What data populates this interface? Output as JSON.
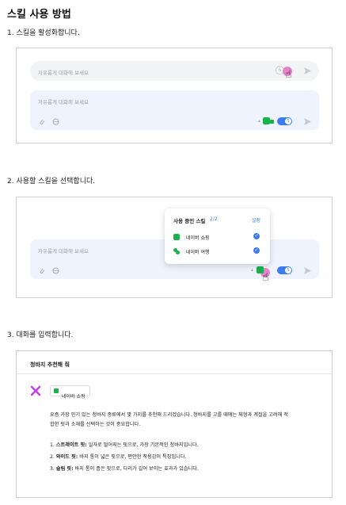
{
  "title": "스킬 사용 방법",
  "steps": {
    "s1": "1. 스킬을 활성화합니다.",
    "s2": "2. 사용할 스킬을 선택합니다.",
    "s3": "3. 대화를 입력합니다."
  },
  "input": {
    "placeholder": "자유롭게 대화해 보세요"
  },
  "popup": {
    "header": "사용 중인 스킬",
    "count": "2/2",
    "settings": "설정",
    "items": [
      {
        "label": "네이버 쇼핑"
      },
      {
        "label": "네이버 여행"
      }
    ]
  },
  "chat": {
    "header": "청바지 추천해 줘",
    "skill_tag": "네이버 쇼핑",
    "intro_line1": "요즘 가장 인기 있는 청바지 종류에서 몇 가지를 추천해 드리겠습니다. 청바지를 고를 때에는 체형과 계절을 고려해 적",
    "intro_line2": "합한 핏과 소재를 선택하는 것이 중요합니다.",
    "list": [
      {
        "num": "1.",
        "bold": "스트레이트 핏:",
        "text": " 일자로 떨어지는 핏으로, 가장 기본적인 청바지입니다."
      },
      {
        "num": "2.",
        "bold": "와이드 핏:",
        "text": " 바지 통이 넓은 핏으로, 편안한 착용감이 특징입니다."
      },
      {
        "num": "3.",
        "bold": "슬림 핏:",
        "text": " 바지 통이 좁은 핏으로, 다리가 길어 보이는 효과가 있습니다."
      }
    ]
  },
  "colors": {
    "accent": "#3b7cf0",
    "green": "#19b34b",
    "pink": "#e46fc4",
    "logo": "#c93df0"
  },
  "icons": {
    "attach": "paperclip-icon",
    "globe": "globe-icon",
    "send": "send-icon",
    "cursor": "hand-pointer-icon",
    "check": "check-icon",
    "logo": "clova-x-logo-icon"
  }
}
